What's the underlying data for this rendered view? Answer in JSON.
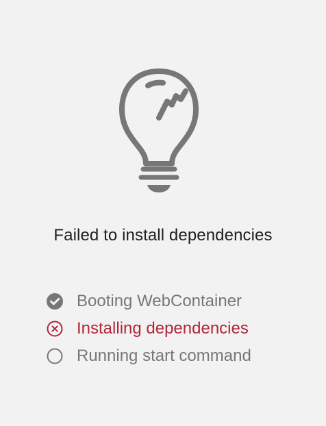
{
  "colors": {
    "background": "#f2f2f2",
    "text_primary": "#1f1f1f",
    "text_muted": "#777777",
    "error": "#b3263a",
    "icon_gray": "#777777"
  },
  "status": {
    "icon": "broken-lightbulb-icon",
    "message": "Failed to install dependencies"
  },
  "steps": [
    {
      "label": "Booting WebContainer",
      "state": "done",
      "icon": "check-circle-icon"
    },
    {
      "label": "Installing dependencies",
      "state": "error",
      "icon": "x-circle-icon"
    },
    {
      "label": "Running start command",
      "state": "pending",
      "icon": "empty-circle-icon"
    }
  ]
}
